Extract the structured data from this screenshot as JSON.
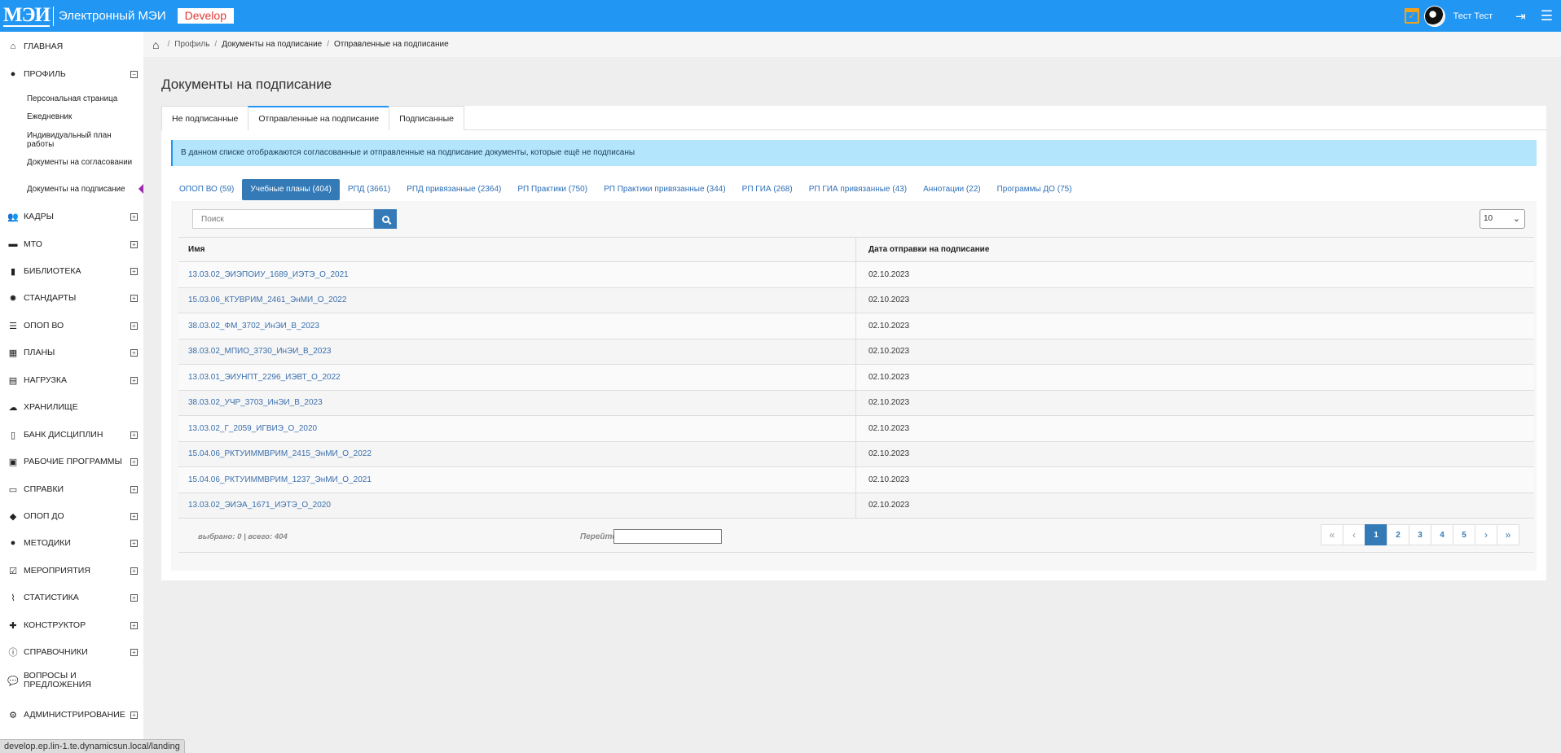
{
  "header": {
    "logo_text": "МЭИ",
    "app_title": "Электронный МЭИ",
    "env_badge": "Develop",
    "user_name": "Тест Тест",
    "icons": [
      "calendar-check-icon",
      "avatar",
      "logout-icon",
      "hamburger-menu-icon"
    ]
  },
  "sidebar": {
    "items": [
      {
        "label": "ГЛАВНАЯ",
        "icon": "home-icon",
        "toggle": ""
      },
      {
        "label": "ПРОФИЛЬ",
        "icon": "user-icon",
        "toggle": "−"
      },
      {
        "label": "КАДРЫ",
        "icon": "users-icon",
        "toggle": "+"
      },
      {
        "label": "МТО",
        "icon": "archive-icon",
        "toggle": "+"
      },
      {
        "label": "БИБЛИОТЕКА",
        "icon": "book-icon",
        "toggle": "+"
      },
      {
        "label": "СТАНДАРТЫ",
        "icon": "certificate-icon",
        "toggle": "+"
      },
      {
        "label": "ОПОП ВО",
        "icon": "list-icon",
        "toggle": "+"
      },
      {
        "label": "ПЛАНЫ",
        "icon": "table-icon",
        "toggle": "+"
      },
      {
        "label": "НАГРУЗКА",
        "icon": "calculator-icon",
        "toggle": "+"
      },
      {
        "label": "ХРАНИЛИЩЕ",
        "icon": "cloud-icon",
        "toggle": ""
      },
      {
        "label": "БАНК ДИСЦИПЛИН",
        "icon": "file-icon",
        "toggle": "+"
      },
      {
        "label": "РАБОЧИЕ ПРОГРАММЫ",
        "icon": "briefcase-icon",
        "toggle": "+"
      },
      {
        "label": "СПРАВКИ",
        "icon": "id-card-icon",
        "toggle": "+"
      },
      {
        "label": "ОПОП ДО",
        "icon": "graduation-cap-icon",
        "toggle": "+"
      },
      {
        "label": "МЕТОДИКИ",
        "icon": "lightbulb-icon",
        "toggle": "+"
      },
      {
        "label": "МЕРОПРИЯТИЯ",
        "icon": "calendar-check-icon",
        "toggle": "+"
      },
      {
        "label": "СТАТИСТИКА",
        "icon": "line-chart-icon",
        "toggle": "+"
      },
      {
        "label": "КОНСТРУКТОР",
        "icon": "puzzle-icon",
        "toggle": "+"
      },
      {
        "label": "СПРАВОЧНИКИ",
        "icon": "info-icon",
        "toggle": "+"
      },
      {
        "label": "ВОПРОСЫ И ПРЕДЛОЖЕНИЯ",
        "icon": "comments-icon",
        "toggle": ""
      },
      {
        "label": "АДМИНИСТРИРОВАНИЕ",
        "icon": "cogs-icon",
        "toggle": "+"
      }
    ],
    "profile_sub": [
      "Персональная страница",
      "Ежедневник",
      "Индивидуальный план работы",
      "Документы на согласовании",
      "Документы на подписание"
    ]
  },
  "breadcrumb": {
    "items": [
      "Профиль",
      "Документы на подписание",
      "Отправленные на подписание"
    ]
  },
  "page": {
    "title": "Документы на подписание",
    "tabs": [
      "Не подписанные",
      "Отправленные на подписание",
      "Подписанные"
    ],
    "info": "В данном списке отображаются согласованные и отправленные на подписание документы, которые ещё не подписаны",
    "pills": [
      {
        "text": "ОПОП ВО (59)"
      },
      {
        "text": "Учебные планы (404)"
      },
      {
        "text": "РПД (3661)"
      },
      {
        "text": "РПД привязанные (2364)"
      },
      {
        "text": "РП Практики (750)"
      },
      {
        "text": "РП Практики привязанные (344)"
      },
      {
        "text": "РП ГИА (268)"
      },
      {
        "text": "РП ГИА привязанные (43)"
      },
      {
        "text": "Аннотации (22)"
      },
      {
        "text": "Программы ДО (75)"
      }
    ]
  },
  "table": {
    "search_placeholder": "Поиск",
    "page_size": "10",
    "columns": [
      "Имя",
      "Дата отправки на подписание"
    ],
    "rows": [
      [
        "13.03.02_ЭИЭПОИУ_1689_ИЭТЭ_О_2021",
        "02.10.2023"
      ],
      [
        "15.03.06_КТУВРИМ_2461_ЭнМИ_О_2022",
        "02.10.2023"
      ],
      [
        "38.03.02_ФМ_3702_ИнЭИ_В_2023",
        "02.10.2023"
      ],
      [
        "38.03.02_МПИО_3730_ИнЭИ_В_2023",
        "02.10.2023"
      ],
      [
        "13.03.01_ЭИУНПТ_2296_ИЭВТ_О_2022",
        "02.10.2023"
      ],
      [
        "38.03.02_УЧР_3703_ИнЭИ_В_2023",
        "02.10.2023"
      ],
      [
        "13.03.02_Г_2059_ИГВИЭ_О_2020",
        "02.10.2023"
      ],
      [
        "15.04.06_РКТУИММВРИМ_2415_ЭнМИ_О_2022",
        "02.10.2023"
      ],
      [
        "15.04.06_РКТУИММВРИМ_1237_ЭнМИ_О_2021",
        "02.10.2023"
      ],
      [
        "13.03.02_ЭИЭА_1671_ИЭТЭ_О_2020",
        "02.10.2023"
      ]
    ],
    "count_text": "выбрано: 0 | всего: 404",
    "goto_label": "Перейти",
    "pages": [
      "1",
      "2",
      "3",
      "4",
      "5"
    ],
    "current_page": "1"
  },
  "status_bar": {
    "url": "develop.ep.lin-1.te.dynamicsun.local/landing"
  }
}
